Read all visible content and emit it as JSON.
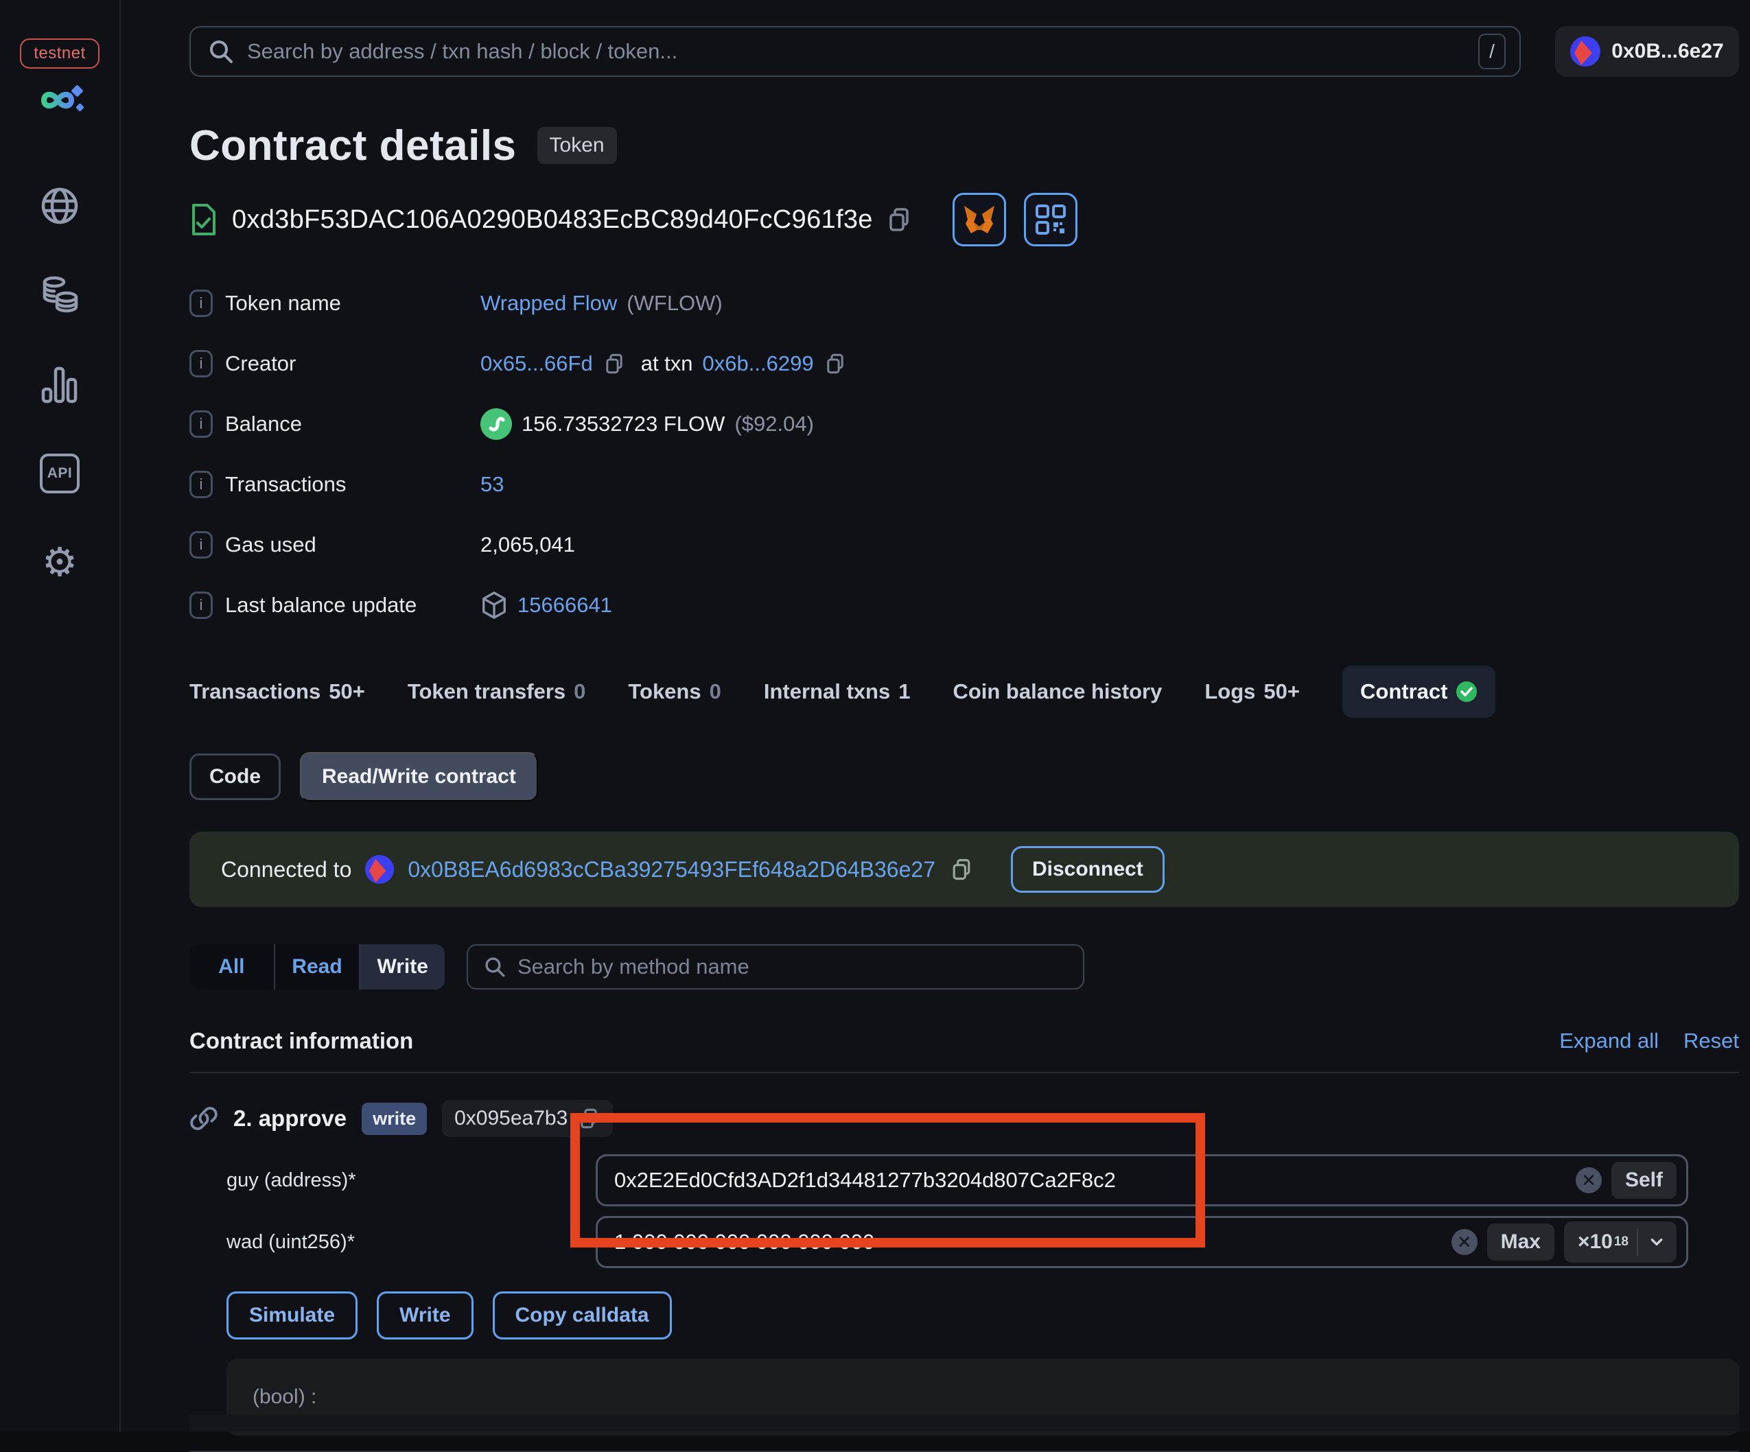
{
  "sidebar": {
    "network_badge": "testnet",
    "icons": {
      "gear_glyph": "⚙",
      "api_label": "API"
    }
  },
  "topbar": {
    "search_placeholder": "Search by address / txn hash / block / token...",
    "shortcut_hint": "/",
    "wallet_address": "0x0B...6e27"
  },
  "header": {
    "title": "Contract details",
    "badge": "Token",
    "contract_address": "0xd3bF53DAC106A0290B0483EcBC89d40FcC961f3e"
  },
  "info": {
    "token_name": {
      "label": "Token name",
      "value": "Wrapped Flow",
      "symbol": "(WFLOW)"
    },
    "creator": {
      "label": "Creator",
      "address": "0x65...66Fd",
      "at_txn": "at txn",
      "txn": "0x6b...6299"
    },
    "balance": {
      "label": "Balance",
      "value": "156.73532723 FLOW",
      "usd": "($92.04)"
    },
    "transactions": {
      "label": "Transactions",
      "value": "53"
    },
    "gas_used": {
      "label": "Gas used",
      "value": "2,065,041"
    },
    "last_balance_update": {
      "label": "Last balance update",
      "value": "15666641"
    }
  },
  "tabs": [
    {
      "label": "Transactions",
      "count": "50+"
    },
    {
      "label": "Token transfers",
      "count": "0"
    },
    {
      "label": "Tokens",
      "count": "0"
    },
    {
      "label": "Internal txns",
      "count": "1"
    },
    {
      "label": "Coin balance history"
    },
    {
      "label": "Logs",
      "count": "50+"
    },
    {
      "label": "Contract"
    }
  ],
  "subtabs": {
    "code": "Code",
    "read_write": "Read/Write contract"
  },
  "connected": {
    "prefix": "Connected to",
    "address": "0x0B8EA6d6983cCBa39275493FEf648a2D64B36e27",
    "disconnect": "Disconnect"
  },
  "filter": {
    "options": [
      "All",
      "Read",
      "Write"
    ],
    "search_placeholder": "Search by method name"
  },
  "contract_info": {
    "title": "Contract information",
    "expand_all": "Expand all",
    "reset": "Reset"
  },
  "method": {
    "name": "2. approve",
    "badge": "write",
    "selector": "0x095ea7b3",
    "fields": [
      {
        "label": "guy (address)*",
        "value": "0x2E2Ed0Cfd3AD2f1d34481277b3204d807Ca2F8c2",
        "action": "Self"
      },
      {
        "label": "wad (uint256)*",
        "value": "1 000 000 000 000 000 000",
        "action": "Max",
        "multiplier": "×10",
        "exponent": "18"
      }
    ],
    "buttons": {
      "simulate": "Simulate",
      "write": "Write",
      "copy_calldata": "Copy calldata"
    },
    "output": "(bool) :"
  },
  "colors": {
    "accent_blue": "#6ba2ec",
    "accent_green": "#35b86b",
    "annotation_red": "#e5431d"
  }
}
